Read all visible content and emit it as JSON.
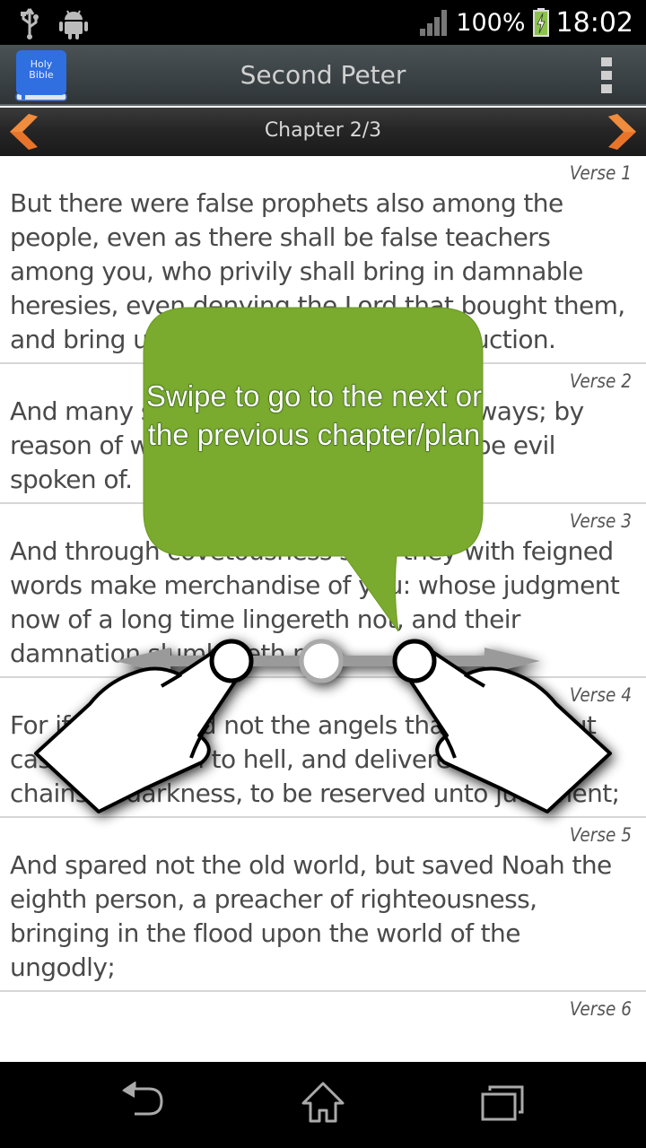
{
  "status_bar": {
    "icons_left": [
      "usb-icon",
      "android-icon"
    ],
    "signal_icon": "signal-icon",
    "battery_percent": "100%",
    "battery_icon": "battery-charging-icon",
    "time": "18:02"
  },
  "action_bar": {
    "logo": {
      "line1": "Holy",
      "line2": "Bible"
    },
    "title": "Second Peter",
    "overflow_icon": "overflow-menu-icon"
  },
  "chapter_bar": {
    "label": "Chapter 2/3",
    "prev_icon": "chevron-left-icon",
    "next_icon": "chevron-right-icon",
    "arrow_color": "#e8742a"
  },
  "verses": [
    {
      "label": "Verse 1",
      "text": "But there were false prophets also among the people, even as there shall be false teachers among you, who privily shall bring in damnable heresies, even denying the Lord that bought them, and bring upon themselves swift destruction."
    },
    {
      "label": "Verse 2",
      "text": "And many shall follow their pernicious ways; by reason of whom the way of truth shall be evil spoken of."
    },
    {
      "label": "Verse 3",
      "text": "And through covetousness shall they with feigned words make merchandise of you: whose judgment now of a long time lingereth not, and their damnation slumbereth not."
    },
    {
      "label": "Verse 4",
      "text": "For if God spared not the angels that sinned, but cast them down to hell, and delivered them into chains of darkness, to be reserved unto judgment;"
    },
    {
      "label": "Verse 5",
      "text": "And spared not the old world, but saved Noah the eighth person, a preacher of righteousness, bringing in the flood upon the world of the ungodly;"
    },
    {
      "label": "Verse 6",
      "text": ""
    }
  ],
  "tutorial": {
    "message": "Swipe to go to the next or the previous chapter/plan",
    "bubble_color": "#7aaa2e",
    "gesture_icon": "swipe-hands-icon"
  },
  "nav_bar": {
    "back_icon": "back-icon",
    "home_icon": "home-icon",
    "recents_icon": "recent-apps-icon"
  }
}
